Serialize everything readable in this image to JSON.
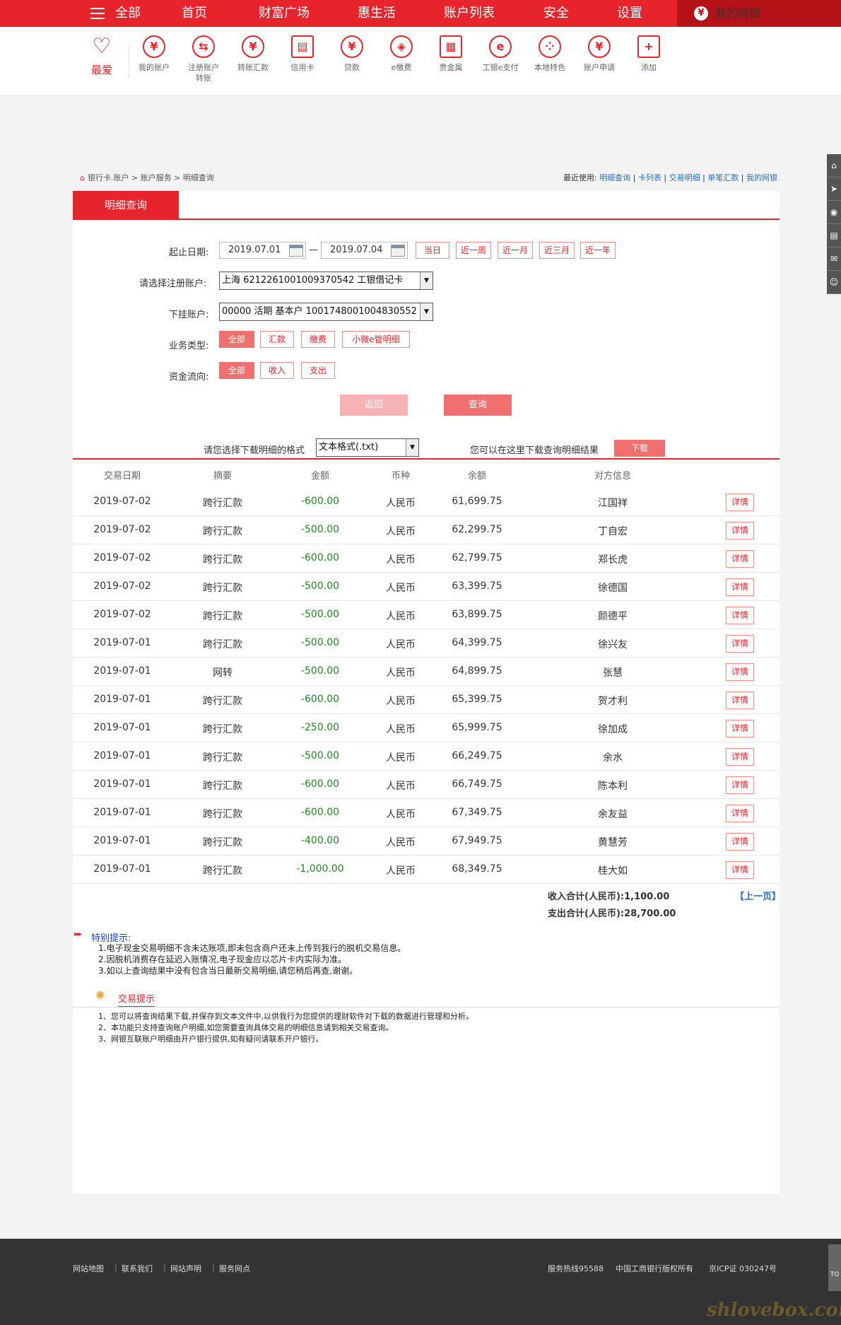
{
  "topnav": {
    "all": "全部",
    "items": [
      "首页",
      "财富广场",
      "惠生活",
      "账户列表",
      "安全",
      "设置"
    ],
    "mybank": "我的网银"
  },
  "iconbar": {
    "fav": "最爱",
    "items": [
      {
        "label": "我的账户",
        "icon": "yuan-icon"
      },
      {
        "label": "注册账户转账",
        "icon": "transfer-icon"
      },
      {
        "label": "转账汇款",
        "icon": "remittance-icon"
      },
      {
        "label": "信用卡",
        "icon": "credit-card-icon"
      },
      {
        "label": "贷款",
        "icon": "loan-icon"
      },
      {
        "label": "e缴费",
        "icon": "payment-icon"
      },
      {
        "label": "贵金属",
        "icon": "gold-icon"
      },
      {
        "label": "工银e支付",
        "icon": "epay-icon"
      },
      {
        "label": "本地特色",
        "icon": "local-icon"
      },
      {
        "label": "账户申请",
        "icon": "apply-icon"
      },
      {
        "label": "添加",
        "icon": "plus-icon"
      }
    ]
  },
  "breadcrumb": {
    "path": "银行卡.账户 > 账户服务 > 明细查询",
    "recent_label": "最近使用:",
    "recent_links": [
      "明细查询",
      "卡列表",
      "交易明细",
      "单笔汇款",
      "我的网银"
    ]
  },
  "tab": {
    "label": "明细查询"
  },
  "form": {
    "date_label": "起止日期:",
    "start_date": "2019.07.01",
    "end_date": "2019.07.04",
    "date_sep": "—",
    "quick_dates": [
      "当日",
      "近一周",
      "近一月",
      "近三月",
      "近一年"
    ],
    "account_label": "请选择注册账户:",
    "account_value": "上海 6212261001009370542 工银借记卡",
    "sub_account_label": "下挂账户:",
    "sub_account_value": "00000 活期 基本户 1001748001004830552",
    "biz_type_label": "业务类型:",
    "biz_types": [
      "全部",
      "汇款",
      "缴费",
      "小微e管明细"
    ],
    "flow_label": "资金流向:",
    "flows": [
      "全部",
      "收入",
      "支出"
    ],
    "back_button": "返回",
    "query_button": "查询"
  },
  "download": {
    "format_label": "请您选择下载明细的格式",
    "format_value": "文本格式(.txt)",
    "hint": "您可以在这里下载查询明细结果",
    "button": "下载"
  },
  "table": {
    "headers": [
      "交易日期",
      "摘要",
      "金额",
      "币种",
      "余额",
      "对方信息"
    ],
    "detail_label": "详情",
    "rows": [
      {
        "date": "2019-07-02",
        "summary": "跨行汇款",
        "amount": "-600.00",
        "currency": "人民币",
        "balance": "61,699.75",
        "party": "江国祥"
      },
      {
        "date": "2019-07-02",
        "summary": "跨行汇款",
        "amount": "-500.00",
        "currency": "人民币",
        "balance": "62,299.75",
        "party": "丁自宏"
      },
      {
        "date": "2019-07-02",
        "summary": "跨行汇款",
        "amount": "-600.00",
        "currency": "人民币",
        "balance": "62,799.75",
        "party": "郑长虎"
      },
      {
        "date": "2019-07-02",
        "summary": "跨行汇款",
        "amount": "-500.00",
        "currency": "人民币",
        "balance": "63,399.75",
        "party": "徐德国"
      },
      {
        "date": "2019-07-02",
        "summary": "跨行汇款",
        "amount": "-500.00",
        "currency": "人民币",
        "balance": "63,899.75",
        "party": "颜德平"
      },
      {
        "date": "2019-07-01",
        "summary": "跨行汇款",
        "amount": "-500.00",
        "currency": "人民币",
        "balance": "64,399.75",
        "party": "徐兴友"
      },
      {
        "date": "2019-07-01",
        "summary": "网转",
        "amount": "-500.00",
        "currency": "人民币",
        "balance": "64,899.75",
        "party": "张慧"
      },
      {
        "date": "2019-07-01",
        "summary": "跨行汇款",
        "amount": "-600.00",
        "currency": "人民币",
        "balance": "65,399.75",
        "party": "贺才利"
      },
      {
        "date": "2019-07-01",
        "summary": "跨行汇款",
        "amount": "-250.00",
        "currency": "人民币",
        "balance": "65,999.75",
        "party": "徐加成"
      },
      {
        "date": "2019-07-01",
        "summary": "跨行汇款",
        "amount": "-500.00",
        "currency": "人民币",
        "balance": "66,249.75",
        "party": "余水"
      },
      {
        "date": "2019-07-01",
        "summary": "跨行汇款",
        "amount": "-600.00",
        "currency": "人民币",
        "balance": "66,749.75",
        "party": "陈本利"
      },
      {
        "date": "2019-07-01",
        "summary": "跨行汇款",
        "amount": "-600.00",
        "currency": "人民币",
        "balance": "67,349.75",
        "party": "余友益"
      },
      {
        "date": "2019-07-01",
        "summary": "跨行汇款",
        "amount": "-400.00",
        "currency": "人民币",
        "balance": "67,949.75",
        "party": "黄慧芳"
      },
      {
        "date": "2019-07-01",
        "summary": "跨行汇款",
        "amount": "-1,000.00",
        "currency": "人民币",
        "balance": "68,349.75",
        "party": "桂大如"
      }
    ]
  },
  "summary": {
    "income_label": "收入合计(人民币):",
    "income": "1,100.00",
    "expense_label": "支出合计(人民币):",
    "expense": "28,700.00",
    "prev_page": "【上一页】"
  },
  "notice": {
    "title": "特别提示:",
    "lines": [
      "1.电子现金交易明细不含未达账项,即未包含商户还未上传到我行的脱机交易信息。",
      "2.因脱机消费存在延迟入账情况,电子现金应以芯片卡内实际为准。",
      "3.如以上查询结果中没有包含当日最新交易明细,请您稍后再查,谢谢。"
    ]
  },
  "hints": {
    "title": "交易提示",
    "lines": [
      "1、您可以将查询结果下载,并保存到文本文件中,以供我行为您提供的理财软件对下载的数据进行管理和分析。",
      "2、本功能只支持查询账户明细,如您需要查询具体交易的明细信息请到相关交易查询。",
      "3、网银互联账户明细由开户银行提供,如有疑问请联系开户银行。"
    ]
  },
  "footer": {
    "links": [
      "网站地图",
      "联系我们",
      "网站声明",
      "服务网点"
    ],
    "hotline": "服务热线95588",
    "copyright": "中国工商银行版权所有",
    "icp": "京ICP证 030247号"
  },
  "side": {
    "totop": "TO"
  },
  "watermark": "shlovebox.com",
  "colors": {
    "brand": "#e7242b",
    "negative": "#1b8a1b",
    "link": "#2a6fc0"
  }
}
